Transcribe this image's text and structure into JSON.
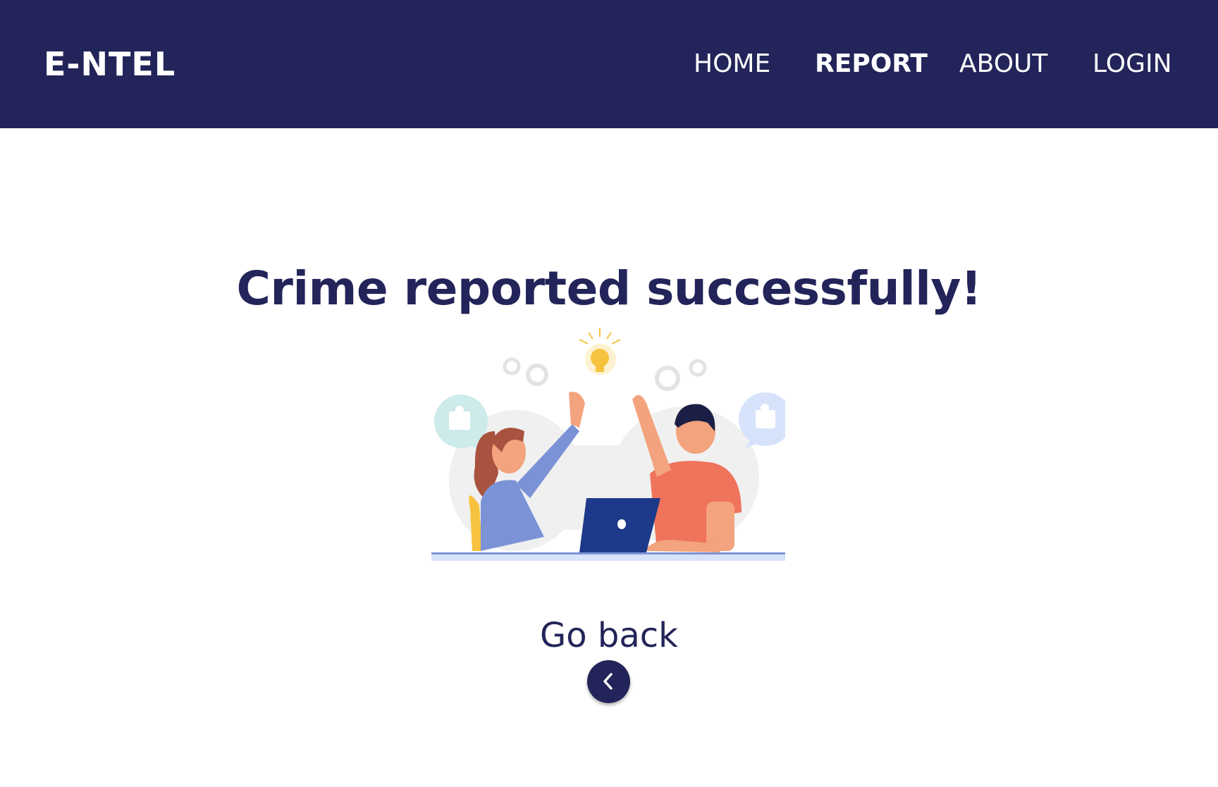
{
  "header": {
    "brand": "E-NTEL",
    "nav": [
      {
        "label": "HOME",
        "active": false
      },
      {
        "label": "REPORT",
        "active": true
      },
      {
        "label": "ABOUT",
        "active": false
      },
      {
        "label": "LOGIN",
        "active": false
      }
    ]
  },
  "main": {
    "title": "Crime reported successfully!",
    "illustration_icon": "high-five-illustration",
    "go_back_label": "Go back",
    "back_button_icon": "chevron-left-icon"
  },
  "colors": {
    "primary": "#232459",
    "background": "#ffffff"
  }
}
